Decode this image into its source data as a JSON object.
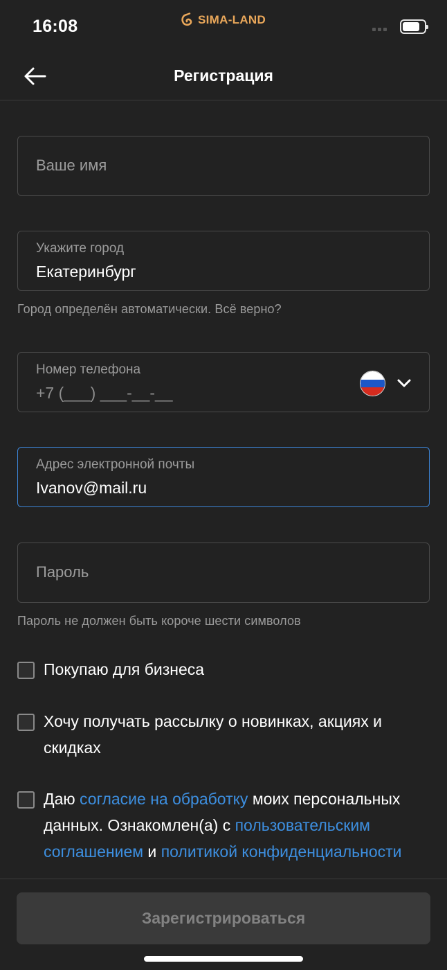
{
  "status_bar": {
    "time": "16:08",
    "brand": "SIMA-LAND",
    "brand_color": "#e9a75a"
  },
  "header": {
    "title": "Регистрация",
    "back_icon": "arrow-left-icon"
  },
  "form": {
    "name": {
      "placeholder": "Ваше имя"
    },
    "city": {
      "label": "Укажите город",
      "value": "Екатеринбург",
      "hint": "Город определён автоматически. Всё верно?"
    },
    "phone": {
      "label": "Номер телефона",
      "value": "+7 (___) ___-__-__",
      "country_icon": "russia-flag-icon"
    },
    "email": {
      "label": "Адрес электронной почты",
      "value": "Ivanov@mail.ru"
    },
    "password": {
      "placeholder": "Пароль",
      "hint": "Пароль не должен быть короче шести символов"
    }
  },
  "checkboxes": {
    "business": {
      "label": "Покупаю для бизнеса",
      "checked": false
    },
    "newsletter": {
      "label": "Хочу получать рассылку о новинках, акциях и скидках",
      "checked": false
    },
    "consent": {
      "text_1": "Даю ",
      "link_1": "согласие на обработку",
      "text_2": " моих персональных данных. Ознакомлен(а) с ",
      "link_2": "пользовательским соглашением",
      "text_3": " и ",
      "link_3": "политикой конфиденциальности",
      "checked": false
    }
  },
  "footer": {
    "submit_label": "Зарегистрироваться"
  },
  "colors": {
    "background": "#222222",
    "focus_border": "#3d86d8",
    "link": "#3d8fe0"
  }
}
